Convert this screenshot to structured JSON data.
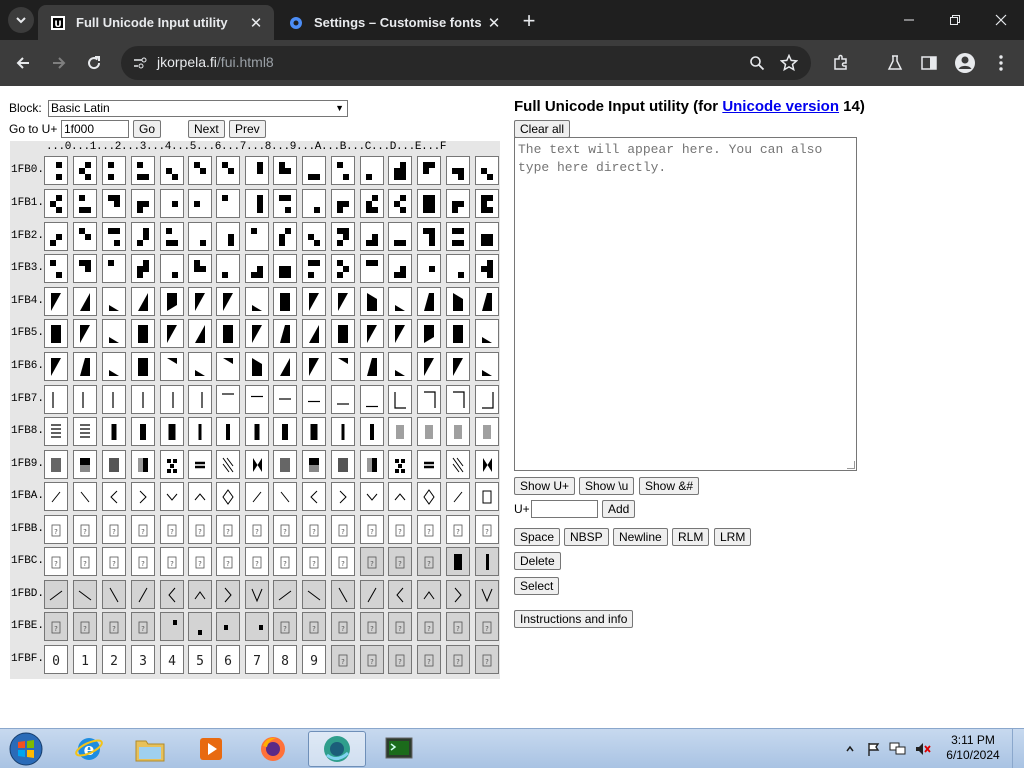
{
  "browser": {
    "tabs": [
      {
        "title": "Full Unicode Input utility",
        "favicon": "page-icon",
        "active": true
      },
      {
        "title": "Settings – Customise fonts",
        "favicon": "gear-icon",
        "active": false
      }
    ],
    "address": {
      "host": "jkorpela.fi",
      "path": "/fui.html8"
    }
  },
  "page": {
    "block_label": "Block:",
    "block_value": "Basic Latin",
    "goto_label": "Go to U+",
    "goto_value": "1f000",
    "go_button": "Go",
    "next_button": "Next",
    "prev_button": "Prev",
    "column_header": "...0...1...2...3...4...5...6...7...8...9...A...B...C...D...E...F",
    "rows": [
      "1FB0.",
      "1FB1.",
      "1FB2.",
      "1FB3.",
      "1FB4.",
      "1FB5.",
      "1FB6.",
      "1FB7.",
      "1FB8.",
      "1FB9.",
      "1FBA.",
      "1FBB.",
      "1FBC.",
      "1FBD.",
      "1FBE.",
      "1FBF."
    ],
    "heading": {
      "prefix": "Full Unicode Input utility (for ",
      "link": "Unicode version",
      "suffix": " 14)"
    },
    "clear_all": "Clear all",
    "textarea_placeholder": "The text will appear here. You can also type here directly.",
    "show_uplus": "Show U+",
    "show_backslash_u": "Show \\u",
    "show_html_entity": "Show &#",
    "uplus_label": "U+",
    "uplus_value": "",
    "add_button": "Add",
    "space_button": "Space",
    "nbsp_button": "NBSP",
    "newline_button": "Newline",
    "rlm_button": "RLM",
    "lrm_button": "LRM",
    "delete_button": "Delete",
    "select_button": "Select",
    "instructions_button": "Instructions and info"
  },
  "taskbar": {
    "apps": [
      "start-orb",
      "internet-explorer",
      "file-explorer",
      "media-player",
      "firefox",
      "chrome-app",
      "terminal-app"
    ],
    "clock_time": "3:11 PM",
    "clock_date": "6/10/2024"
  }
}
